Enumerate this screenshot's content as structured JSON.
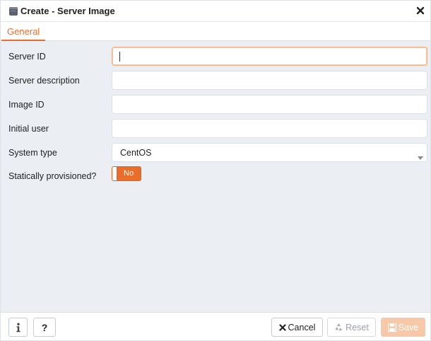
{
  "dialog": {
    "title": "Create - Server Image",
    "title_icon": "server-image-icon",
    "close_icon": "close-icon"
  },
  "tabs": [
    {
      "label": "General",
      "active": true
    }
  ],
  "form": {
    "server_id": {
      "label": "Server ID",
      "value": "",
      "focused": true
    },
    "server_description": {
      "label": "Server description",
      "value": ""
    },
    "image_id": {
      "label": "Image ID",
      "value": ""
    },
    "initial_user": {
      "label": "Initial user",
      "value": ""
    },
    "system_type": {
      "label": "System type",
      "selected": "CentOS"
    },
    "statically_provisioned": {
      "label": "Statically provisioned?",
      "state": "No"
    }
  },
  "footer": {
    "info_icon": "info-icon",
    "help_label": "?",
    "cancel_label": "Cancel",
    "cancel_icon": "close-icon",
    "reset_label": "Reset",
    "reset_icon": "recycle-icon",
    "save_label": "Save",
    "save_icon": "floppy-disk-icon"
  },
  "colors": {
    "accent": "#e86e2a",
    "body_background": "#ebeef3",
    "save_disabled": "#f7c9a8"
  }
}
